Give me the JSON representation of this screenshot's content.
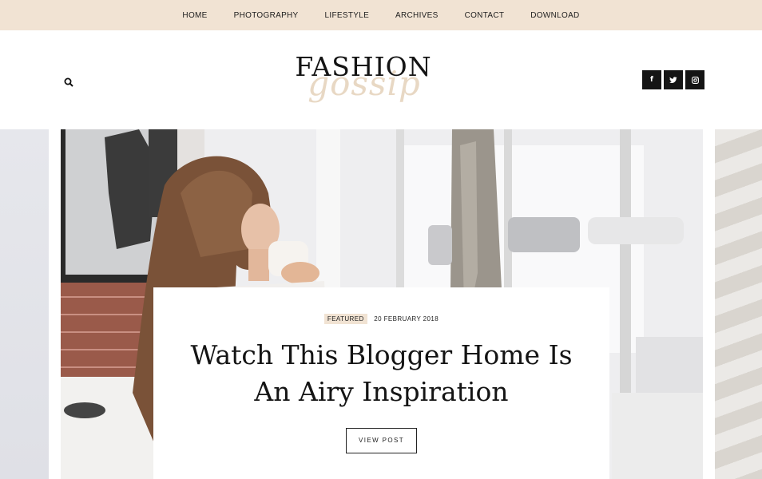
{
  "nav": {
    "items": [
      "HOME",
      "PHOTOGRAPHY",
      "LIFESTYLE",
      "ARCHIVES",
      "CONTACT",
      "DOWNLOAD"
    ]
  },
  "header": {
    "logo_main": "FASHION",
    "logo_script": "gossip",
    "search_icon": "search-icon",
    "socials": [
      {
        "name": "facebook-icon",
        "glyph": "f"
      },
      {
        "name": "twitter-icon",
        "glyph": "t"
      },
      {
        "name": "instagram-icon",
        "glyph": "◘"
      }
    ]
  },
  "featured_post": {
    "badge": "FEATURED",
    "date": "20 FEBRUARY 2018",
    "title": "Watch This Blogger Home Is An Airy Inspiration",
    "button": "VIEW POST"
  },
  "colors": {
    "nav_bg": "#f1e3d3",
    "accent": "#f1e3d3",
    "dark": "#151515"
  }
}
